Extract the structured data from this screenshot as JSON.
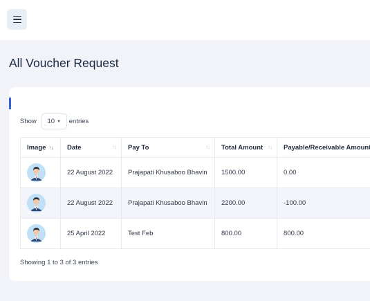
{
  "header": {
    "menu_icon": "hamburger-icon"
  },
  "page": {
    "title": "All Voucher Request"
  },
  "controls": {
    "show_label": "Show",
    "length_value": "10",
    "entries_label": "entries"
  },
  "table": {
    "columns": [
      "Image",
      "Date",
      "Pay To",
      "Total Amount",
      "Payable/Receivable Amount"
    ],
    "rows": [
      {
        "date": "22 August 2022",
        "pay_to": "Prajapati Khusaboo Bhavin",
        "total": "1500.00",
        "payable": "0.00"
      },
      {
        "date": "22 August 2022",
        "pay_to": "Prajapati Khusaboo Bhavin",
        "total": "2200.00",
        "payable": "-100.00"
      },
      {
        "date": "25 April 2022",
        "pay_to": "Test Feb",
        "total": "800.00",
        "payable": "800.00"
      }
    ]
  },
  "footer": {
    "info": "Showing 1 to 3 of 3 entries"
  },
  "colors": {
    "accent": "#3b63d8",
    "background": "#f1f3f9",
    "stripe": "#f3f5fa"
  }
}
